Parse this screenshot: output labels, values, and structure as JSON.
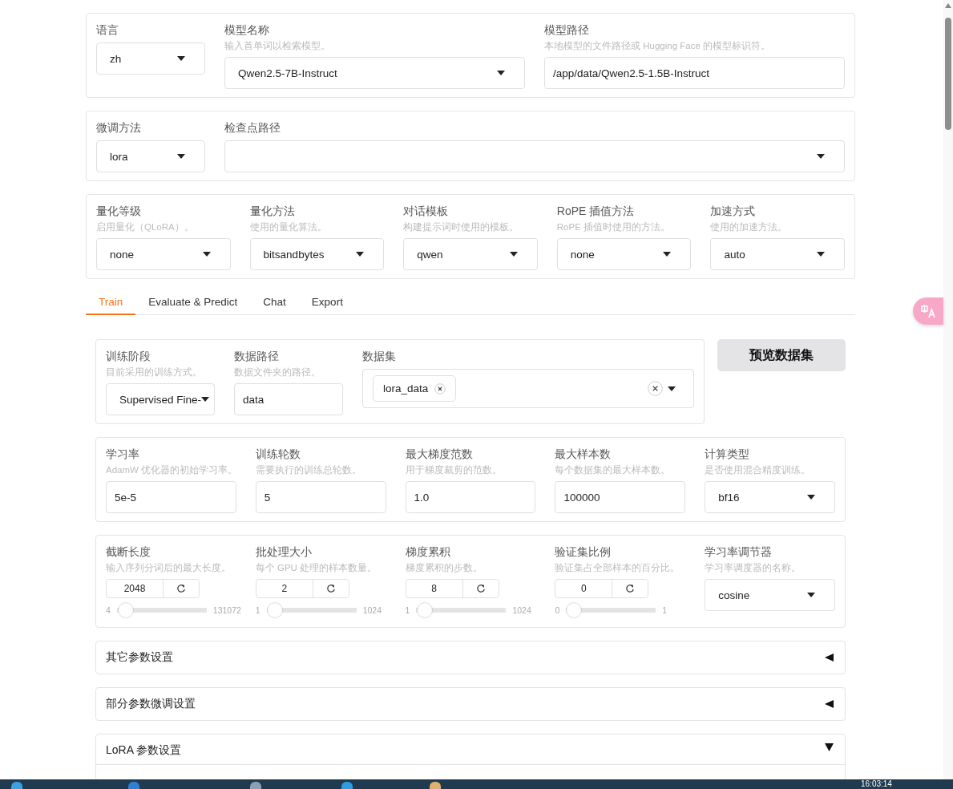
{
  "settings_panels": [
    {
      "fields": [
        {
          "kind": "dropdown",
          "label": "语言",
          "value": "zh"
        },
        {
          "kind": "dropdown",
          "label": "模型名称",
          "hint": "输入首单词以检索模型。",
          "value": "Qwen2.5-7B-Instruct"
        },
        {
          "kind": "text",
          "label": "模型路径",
          "hint": "本地模型的文件路径或 Hugging Face 的模型标识符。",
          "value": "/app/data/Qwen2.5-1.5B-Instruct"
        }
      ]
    },
    {
      "fields": [
        {
          "kind": "dropdown",
          "label": "微调方法",
          "value": "lora"
        },
        {
          "kind": "dropdown",
          "label": "检查点路径"
        }
      ]
    },
    {
      "fields": [
        {
          "kind": "dropdown",
          "label": "量化等级",
          "hint": "启用量化（QLoRA）。",
          "value": "none"
        },
        {
          "kind": "dropdown",
          "label": "量化方法",
          "hint": "使用的量化算法。",
          "value": "bitsandbytes"
        },
        {
          "kind": "dropdown",
          "label": "对话模板",
          "hint": "构建提示词时使用的模板。",
          "value": "qwen"
        },
        {
          "kind": "dropdown",
          "label": "RoPE 插值方法",
          "hint": "RoPE 插值时使用的方法。",
          "value": "none"
        },
        {
          "kind": "dropdown",
          "label": "加速方式",
          "hint": "使用的加速方法。",
          "value": "auto"
        }
      ]
    }
  ],
  "tabs": [
    {
      "label": "Train",
      "selected": true
    },
    {
      "label": "Evaluate & Predict",
      "selected": false
    },
    {
      "label": "Chat",
      "selected": false
    },
    {
      "label": "Export",
      "selected": false
    }
  ],
  "train": {
    "stage_panel": {
      "fields": [
        {
          "kind": "dropdown",
          "label": "训练阶段",
          "hint": "目前采用的训练方式。",
          "value": "Supervised Fine-"
        },
        {
          "kind": "text",
          "label": "数据路径",
          "hint": "数据文件夹的路径。",
          "value": "data"
        },
        {
          "kind": "multiselect",
          "label": "数据集",
          "chips": [
            "lora_data"
          ]
        }
      ]
    },
    "preview_button": "预览数据集",
    "panels": [
      {
        "fields": [
          {
            "kind": "text",
            "label": "学习率",
            "hint": "AdamW 优化器的初始学习率。",
            "value": "5e-5"
          },
          {
            "kind": "text",
            "label": "训练轮数",
            "hint": "需要执行的训练总轮数。",
            "value": "5"
          },
          {
            "kind": "text",
            "label": "最大梯度范数",
            "hint": "用于梯度裁剪的范数。",
            "value": "1.0"
          },
          {
            "kind": "text",
            "label": "最大样本数",
            "hint": "每个数据集的最大样本数。",
            "value": "100000"
          },
          {
            "kind": "dropdown",
            "label": "计算类型",
            "hint": "是否使用混合精度训练。",
            "value": "bf16"
          }
        ]
      },
      {
        "fields": [
          {
            "kind": "slider",
            "label": "截断长度",
            "hint": "输入序列分词后的最大长度。",
            "value": "2048",
            "min": "4",
            "max": "131072",
            "level": 0.016
          },
          {
            "kind": "slider",
            "label": "批处理大小",
            "hint": "每个 GPU 处理的样本数量。",
            "value": "2",
            "min": "1",
            "max": "1024",
            "level": 0.001
          },
          {
            "kind": "slider",
            "label": "梯度累积",
            "hint": "梯度累积的步数。",
            "value": "8",
            "min": "1",
            "max": "1024",
            "level": 0.007
          },
          {
            "kind": "slider",
            "label": "验证集比例",
            "hint": "验证集占全部样本的百分比。",
            "value": "0",
            "min": "0",
            "max": "1",
            "level": 0
          },
          {
            "kind": "dropdown",
            "label": "学习率调节器",
            "hint": "学习率调度器的名称。",
            "value": "cosine"
          }
        ]
      }
    ],
    "accordions": [
      {
        "title": "其它参数设置",
        "expanded": false
      },
      {
        "title": "部分参数微调设置",
        "expanded": false
      },
      {
        "title": "LoRA 参数设置",
        "expanded": true
      }
    ]
  },
  "taskbar": {
    "clock": "16:03:14"
  }
}
